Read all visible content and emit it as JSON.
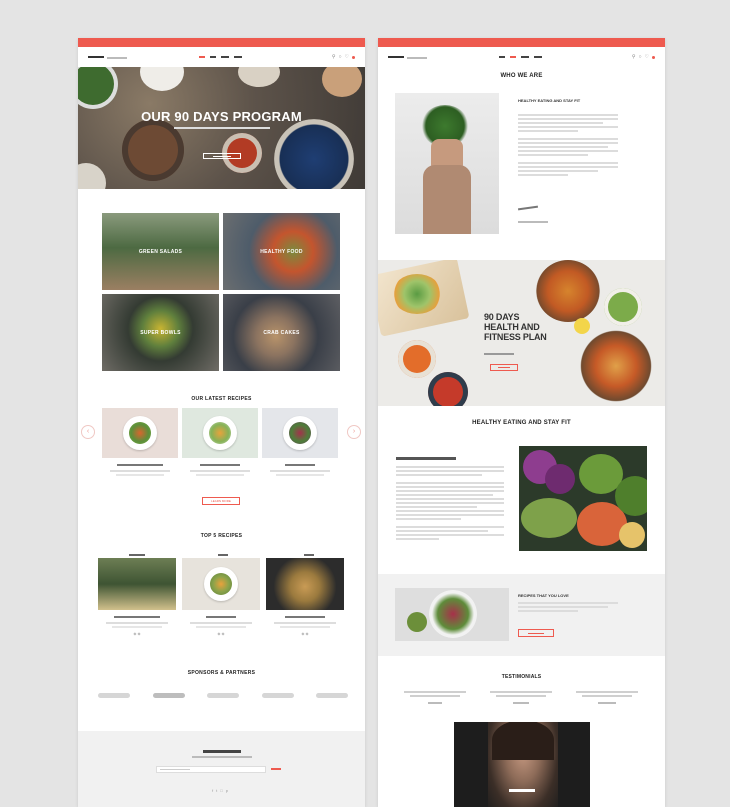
{
  "colors": {
    "accent": "#ee5a4f",
    "canvas": "#e4e4e4"
  },
  "left_page": {
    "hero": {
      "title": "OUR 90 DAYS PROGRAM"
    },
    "categories": [
      {
        "label": "GREEN SALADS"
      },
      {
        "label": "HEALTHY FOOD"
      },
      {
        "label": "SUPER BOWLS"
      },
      {
        "label": "CRAB CAKES"
      }
    ],
    "latest_recipes": {
      "title": "OUR LATEST RECIPES",
      "button": "LEARN MORE"
    },
    "top_recipes": {
      "title": "TOP 5 RECIPES"
    },
    "sponsors": {
      "title": "SPONSORS & PARTNERS"
    }
  },
  "right_page": {
    "who_we_are": {
      "title": "WHO WE ARE",
      "heading": "HEALTHY EATING AND STAY FIT"
    },
    "banner": {
      "title_line1": "90 DAYS",
      "title_line2": "HEALTH AND",
      "title_line3": "FITNESS PLAN"
    },
    "healthy": {
      "title": "HEALTHY EATING AND STAY FIT"
    },
    "favorites": {
      "heading": "RECIPES THAT YOU LOVE"
    },
    "testimonials": {
      "title": "TESTIMONIALS"
    }
  },
  "icons": [
    "search-icon",
    "user-icon",
    "heart-icon",
    "cart-icon",
    "arrow-left-icon",
    "arrow-right-icon",
    "play-icon"
  ]
}
